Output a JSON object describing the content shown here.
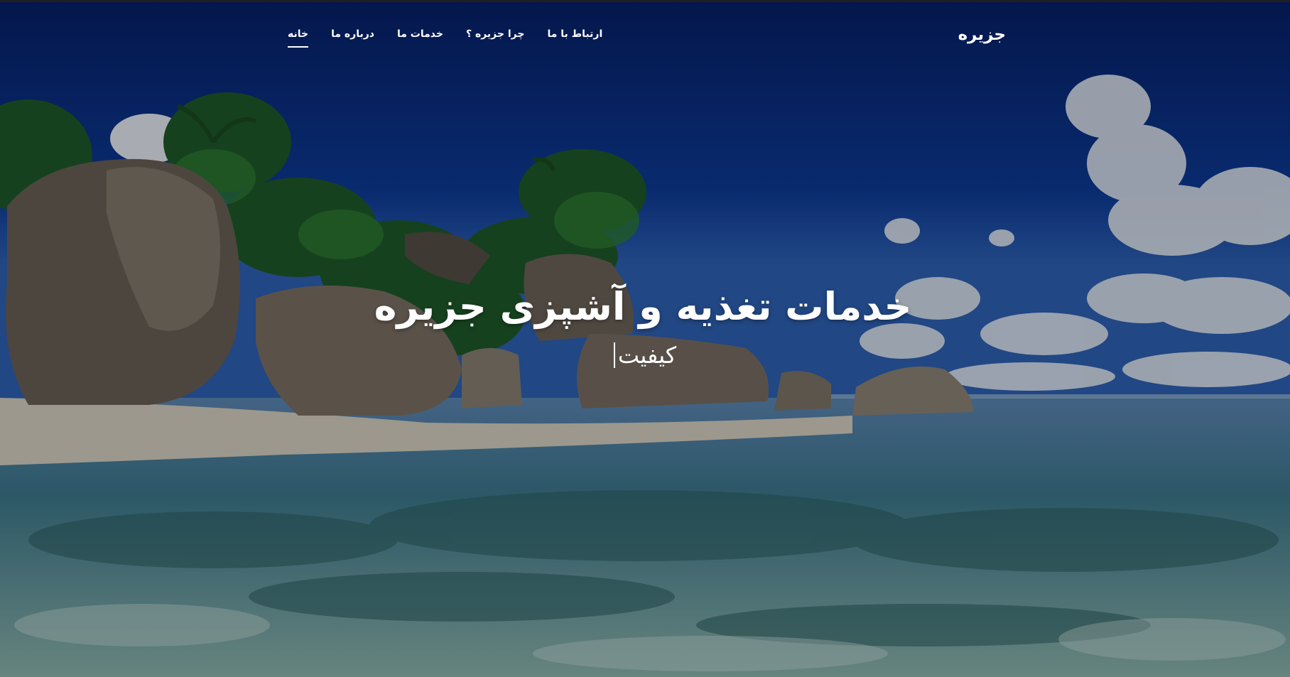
{
  "brand": {
    "name": "جزیره"
  },
  "nav": {
    "items": [
      {
        "label": "خانه",
        "active": true
      },
      {
        "label": "درباره ما",
        "active": false
      },
      {
        "label": "خدمات ما",
        "active": false
      },
      {
        "label": "چرا جزیره ؟",
        "active": false
      },
      {
        "label": "ارتباط با ما",
        "active": false
      }
    ]
  },
  "hero": {
    "title": "خدمات تغذیه و آشپزی جزیره",
    "typed_word": "کیفیت"
  },
  "colors": {
    "nav_text": "#ffffff",
    "sky": "#0b2a78",
    "overlay": "rgba(0,0,0,0.28)"
  }
}
